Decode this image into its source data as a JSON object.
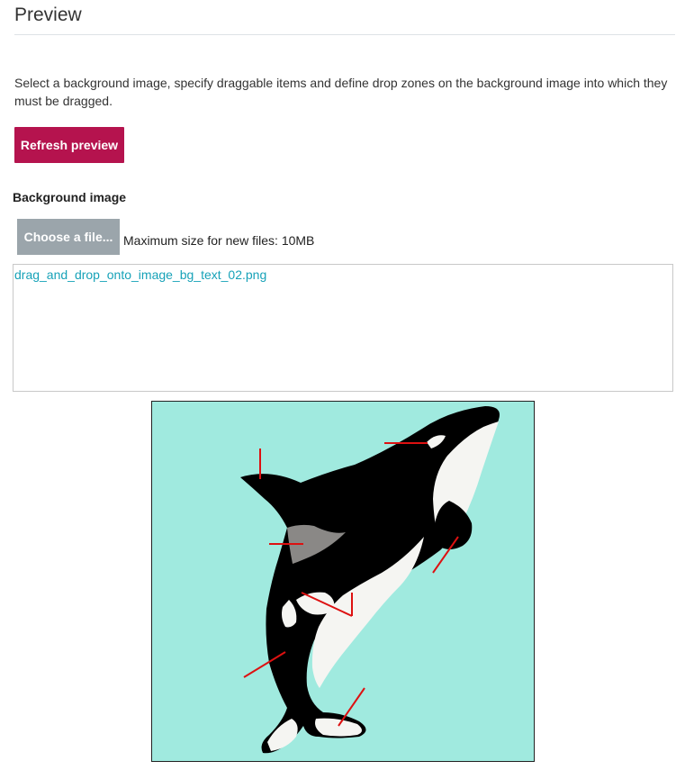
{
  "header": {
    "title": "Preview"
  },
  "description": "Select a background image, specify draggable items and define drop zones on the background image into which they must be dragged.",
  "buttons": {
    "refresh_label": "Refresh preview"
  },
  "background_image": {
    "label": "Background image",
    "choose_label": "Choose a file...",
    "max_size_text": "Maximum size for new files: 10MB",
    "file_name": "drag_and_drop_onto_image_bg_text_02.png"
  },
  "colors": {
    "accent": "#b5134e",
    "file_link": "#17a2b8",
    "image_background": "#a0eadf",
    "marker_line": "#dd1111"
  },
  "icons": {
    "preview_image": "orca-whale-image"
  }
}
